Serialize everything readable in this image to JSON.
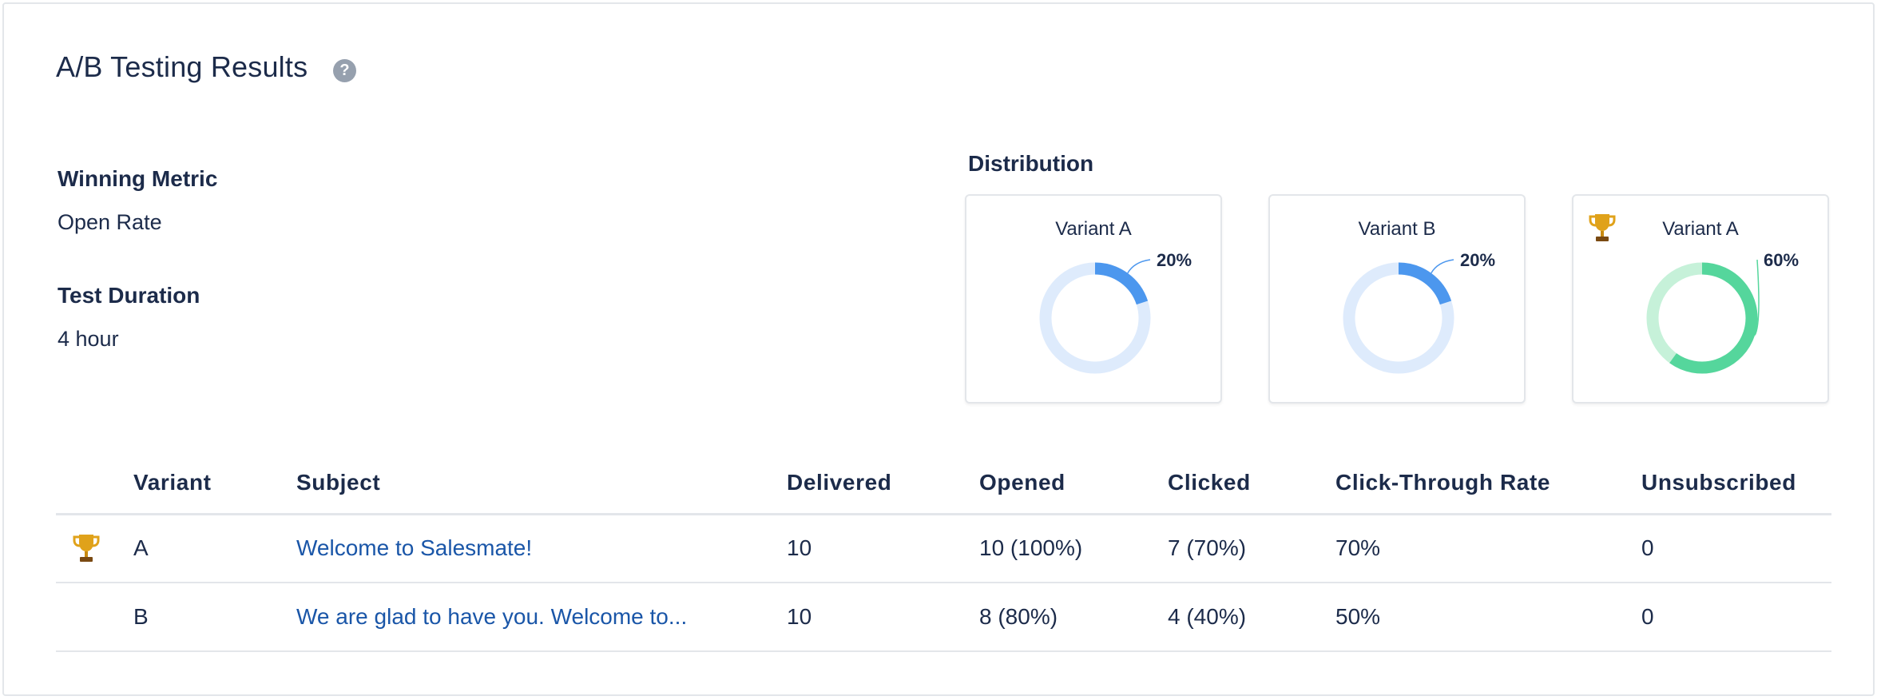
{
  "page": {
    "title": "A/B Testing Results",
    "help_glyph": "?"
  },
  "settings": {
    "winning_metric_label": "Winning Metric",
    "winning_metric_value": "Open Rate",
    "test_duration_label": "Test Duration",
    "test_duration_value": "4 hour"
  },
  "distribution": {
    "title": "Distribution",
    "cards": [
      {
        "name": "Variant A",
        "percent_label": "20%",
        "fraction": 0.2,
        "winner": false,
        "track_color": "#deebfc",
        "fill_color": "#4c97ee"
      },
      {
        "name": "Variant B",
        "percent_label": "20%",
        "fraction": 0.2,
        "winner": false,
        "track_color": "#deebfc",
        "fill_color": "#4c97ee"
      },
      {
        "name": "Variant A",
        "percent_label": "60%",
        "fraction": 0.6,
        "winner": true,
        "track_color": "#c6f1d9",
        "fill_color": "#55d69c"
      }
    ]
  },
  "table": {
    "headers": [
      "Variant",
      "Subject",
      "Delivered",
      "Opened",
      "Clicked",
      "Click-Through Rate",
      "Unsubscribed"
    ],
    "rows": [
      {
        "winner": true,
        "variant": "A",
        "subject": "Welcome to Salesmate!",
        "delivered": "10",
        "opened": "10 (100%)",
        "clicked": "7 (70%)",
        "ctr": "70%",
        "unsubscribed": "0"
      },
      {
        "winner": false,
        "variant": "B",
        "subject": "We are glad to have you. Welcome to...",
        "delivered": "10",
        "opened": "8 (80%)",
        "clicked": "4 (40%)",
        "ctr": "50%",
        "unsubscribed": "0"
      }
    ]
  },
  "icons": {
    "help": "help-circle-icon",
    "winner": "trophy-icon"
  },
  "colors": {
    "text": "#1c2b4a",
    "link": "#1a56a8",
    "border": "#e3e6ea",
    "trophy": "#e0a21a"
  }
}
